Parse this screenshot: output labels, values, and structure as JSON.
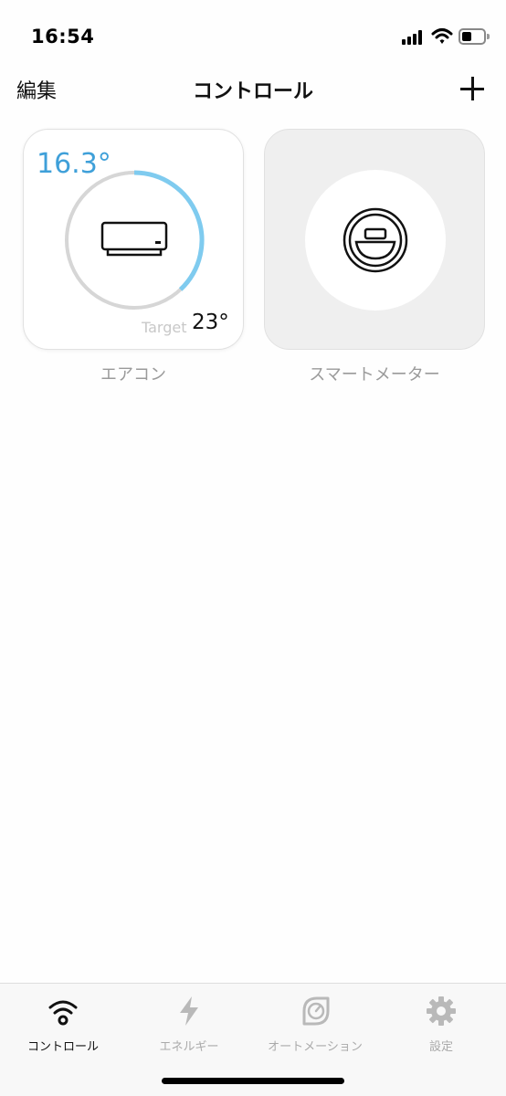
{
  "status_bar": {
    "time": "16:54",
    "icons": [
      "cellular-signal-icon",
      "wifi-icon",
      "battery-icon"
    ],
    "battery_level": 0.35
  },
  "nav": {
    "edit_label": "編集",
    "title": "コントロール",
    "add_icon": "plus-icon"
  },
  "tiles": [
    {
      "label": "エアコン",
      "current_temp": "16.3°",
      "target_label": "Target",
      "target_temp": "23°",
      "icon": "air-conditioner-icon",
      "gauge_fraction": 0.38,
      "accent_color": "#3fa0d9",
      "arc_color": "#7fcbef"
    },
    {
      "label": "スマートメーター",
      "icon": "smart-meter-icon"
    }
  ],
  "tabs": [
    {
      "label": "コントロール",
      "icon": "wifi-control-icon",
      "active": true
    },
    {
      "label": "エネルギー",
      "icon": "lightning-icon",
      "active": false
    },
    {
      "label": "オートメーション",
      "icon": "gauge-icon",
      "active": false
    },
    {
      "label": "設定",
      "icon": "gear-icon",
      "active": false
    }
  ]
}
